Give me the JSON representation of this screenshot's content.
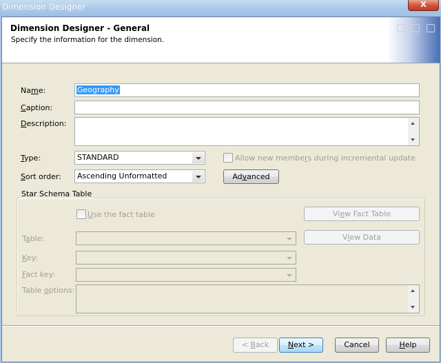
{
  "window": {
    "title": "Dimension Designer",
    "close_label": "X"
  },
  "header": {
    "title": "Dimension Designer - General",
    "subtitle": "Specify the information for the dimension."
  },
  "form": {
    "name": {
      "label_pre": "Na",
      "label_u": "m",
      "label_post": "e:",
      "value": "Geography"
    },
    "caption": {
      "label_pre": "",
      "label_u": "C",
      "label_post": "aption:",
      "value": ""
    },
    "description": {
      "label_pre": "",
      "label_u": "D",
      "label_post": "escription:",
      "value": ""
    },
    "type": {
      "label_pre": "",
      "label_u": "T",
      "label_post": "ype:",
      "value": "STANDARD"
    },
    "sort_order": {
      "label_pre": "",
      "label_u": "S",
      "label_post": "ort order:",
      "value": "Ascending Unformatted"
    },
    "allow_new_members": {
      "label_pre": "Allow new membe",
      "label_u": "r",
      "label_post": "s during incremental update",
      "checked": false,
      "enabled": false
    },
    "advanced_button": {
      "label_pre": "Ad",
      "label_u": "v",
      "label_post": "anced"
    }
  },
  "star_schema": {
    "title": "Star Schema Table",
    "use_fact_table": {
      "label_pre": "",
      "label_u": "U",
      "label_post": "se the fact table",
      "checked": false,
      "enabled": false
    },
    "view_fact_table_button": {
      "label_pre": "Vi",
      "label_u": "e",
      "label_post": "w Fact Table"
    },
    "view_data_button": {
      "label_pre": "V",
      "label_u": "i",
      "label_post": "ew Data"
    },
    "table": {
      "label_pre": "T",
      "label_u": "a",
      "label_post": "ble:",
      "value": ""
    },
    "key": {
      "label_pre": "",
      "label_u": "K",
      "label_post": "ey:",
      "value": ""
    },
    "fact_key": {
      "label_pre": "",
      "label_u": "F",
      "label_post": "act key:",
      "value": ""
    },
    "table_options": {
      "label_pre": "Table ",
      "label_u": "o",
      "label_post": "ptions:",
      "value": ""
    }
  },
  "footer": {
    "back": {
      "label_pre": "< ",
      "label_u": "B",
      "label_post": "ack"
    },
    "next": {
      "label_pre": "",
      "label_u": "N",
      "label_post": "ext >"
    },
    "cancel": {
      "label": "Cancel"
    },
    "help": {
      "label_pre": "",
      "label_u": "H",
      "label_post": "elp"
    }
  }
}
